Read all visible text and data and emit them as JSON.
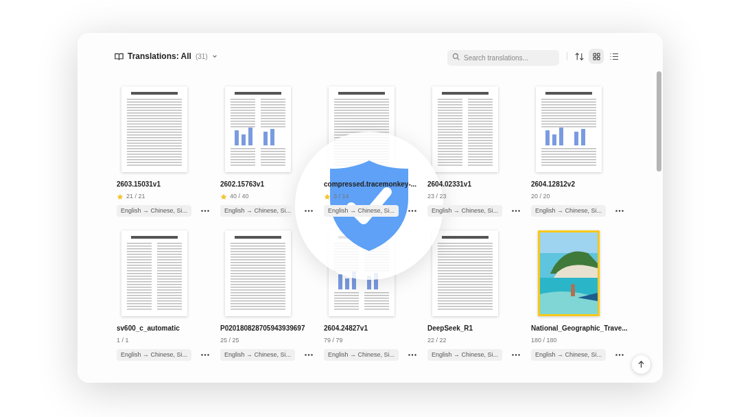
{
  "header": {
    "title": "Translations: All",
    "count": "(31)"
  },
  "search": {
    "placeholder": "Search translations..."
  },
  "view_modes": [
    {
      "kind": "grid",
      "selected": true
    },
    {
      "kind": "list",
      "selected": false
    }
  ],
  "documents": [
    {
      "title": "2603.15031v1",
      "pages": "21 / 21",
      "starred": true,
      "languages": "English → Chinese, Si...",
      "kind": "paper"
    },
    {
      "title": "2602.15763v1",
      "pages": "40 / 40",
      "starred": true,
      "languages": "English → Chinese, Si...",
      "kind": "paper"
    },
    {
      "title": "compressed.tracemonkey-...",
      "pages": "3 / 14",
      "starred": true,
      "languages": "English → Chinese, Si...",
      "kind": "paper"
    },
    {
      "title": "2604.02331v1",
      "pages": "23 / 23",
      "starred": false,
      "languages": "English → Chinese, Si...",
      "kind": "paper"
    },
    {
      "title": "2604.12812v2",
      "pages": "20 / 20",
      "starred": false,
      "languages": "English → Chinese, Si...",
      "kind": "paper"
    },
    {
      "title": "sv600_c_automatic",
      "pages": "1 / 1",
      "starred": false,
      "languages": "English → Chinese, Si...",
      "kind": "paper"
    },
    {
      "title": "P020180828705943939697",
      "pages": "25 / 25",
      "starred": false,
      "languages": "English → Chinese, Si...",
      "kind": "paper"
    },
    {
      "title": "2604.24827v1",
      "pages": "79 / 79",
      "starred": false,
      "languages": "English → Chinese, Si...",
      "kind": "paper"
    },
    {
      "title": "DeepSeek_R1",
      "pages": "22 / 22",
      "starred": false,
      "languages": "English → Chinese, Si...",
      "kind": "paper"
    },
    {
      "title": "National_Geographic_Trave...",
      "pages": "180 / 180",
      "starred": false,
      "languages": "English → Chinese, Si...",
      "kind": "picture"
    }
  ]
}
